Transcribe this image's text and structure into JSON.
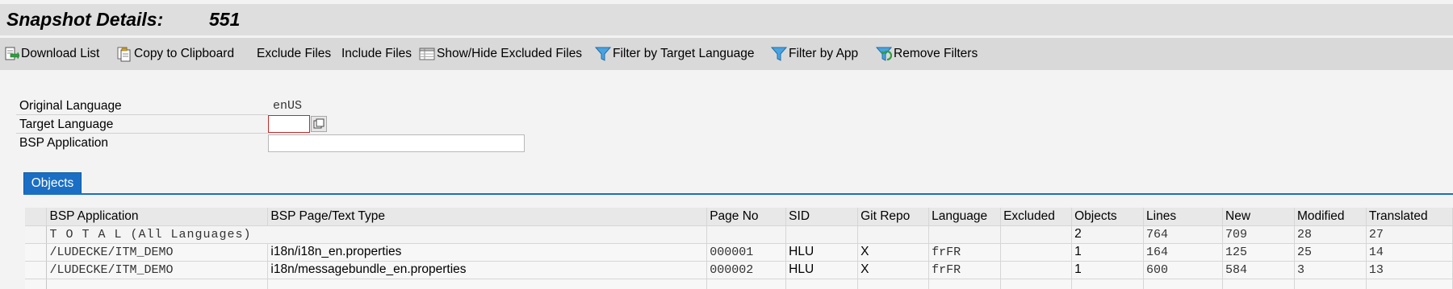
{
  "header": {
    "title": "Snapshot Details:",
    "snapshot_id": "551"
  },
  "toolbar": {
    "buttons": [
      {
        "label": "Download List",
        "icon": "download-icon"
      },
      {
        "label": "Copy to Clipboard",
        "icon": "clipboard-icon"
      },
      {
        "label": "Exclude Files"
      },
      {
        "label": "Include Files"
      },
      {
        "label": "Show/Hide Excluded Files",
        "icon": "table-icon"
      },
      {
        "label": "Filter by Target Language",
        "icon": "filter-icon"
      },
      {
        "label": "Filter by App",
        "icon": "filter-icon"
      },
      {
        "label": "Remove Filters",
        "icon": "remove-filter-icon"
      }
    ]
  },
  "form": {
    "original_language_label": "Original Language",
    "original_language_value": "enUS",
    "target_language_label": "Target Language",
    "target_language_value": "",
    "bsp_application_label": "BSP Application",
    "bsp_application_value": ""
  },
  "tabs": [
    {
      "label": "Objects"
    }
  ],
  "table": {
    "columns": [
      "BSP Application",
      "BSP Page/Text Type",
      "Page No",
      "SID",
      "Git Repo",
      "Language",
      "Excluded",
      "Objects",
      "Lines",
      "New",
      "Modified",
      "Translated"
    ],
    "total_row": {
      "label": "T O T A L  (All Languages)",
      "objects": "2",
      "lines": "764",
      "new": "709",
      "modified": "28",
      "translated": "27"
    },
    "rows": [
      {
        "app": "/LUDECKE/ITM_DEMO",
        "page": "i18n/i18n_en.properties",
        "page_no": "000001",
        "sid": "HLU",
        "git_repo": "X",
        "language": "frFR",
        "excluded": "",
        "objects": "1",
        "lines": "164",
        "new": "125",
        "modified": "25",
        "translated": "14"
      },
      {
        "app": "/LUDECKE/ITM_DEMO",
        "page": "i18n/messagebundle_en.properties",
        "page_no": "000002",
        "sid": "HLU",
        "git_repo": "X",
        "language": "frFR",
        "excluded": "",
        "objects": "1",
        "lines": "600",
        "new": "584",
        "modified": "3",
        "translated": "13"
      }
    ]
  },
  "colors": {
    "accent": "#1a6fc4",
    "focus_border": "#c62828",
    "title_bg": "#dedede",
    "toolbar_bg": "#d9d9d9"
  }
}
